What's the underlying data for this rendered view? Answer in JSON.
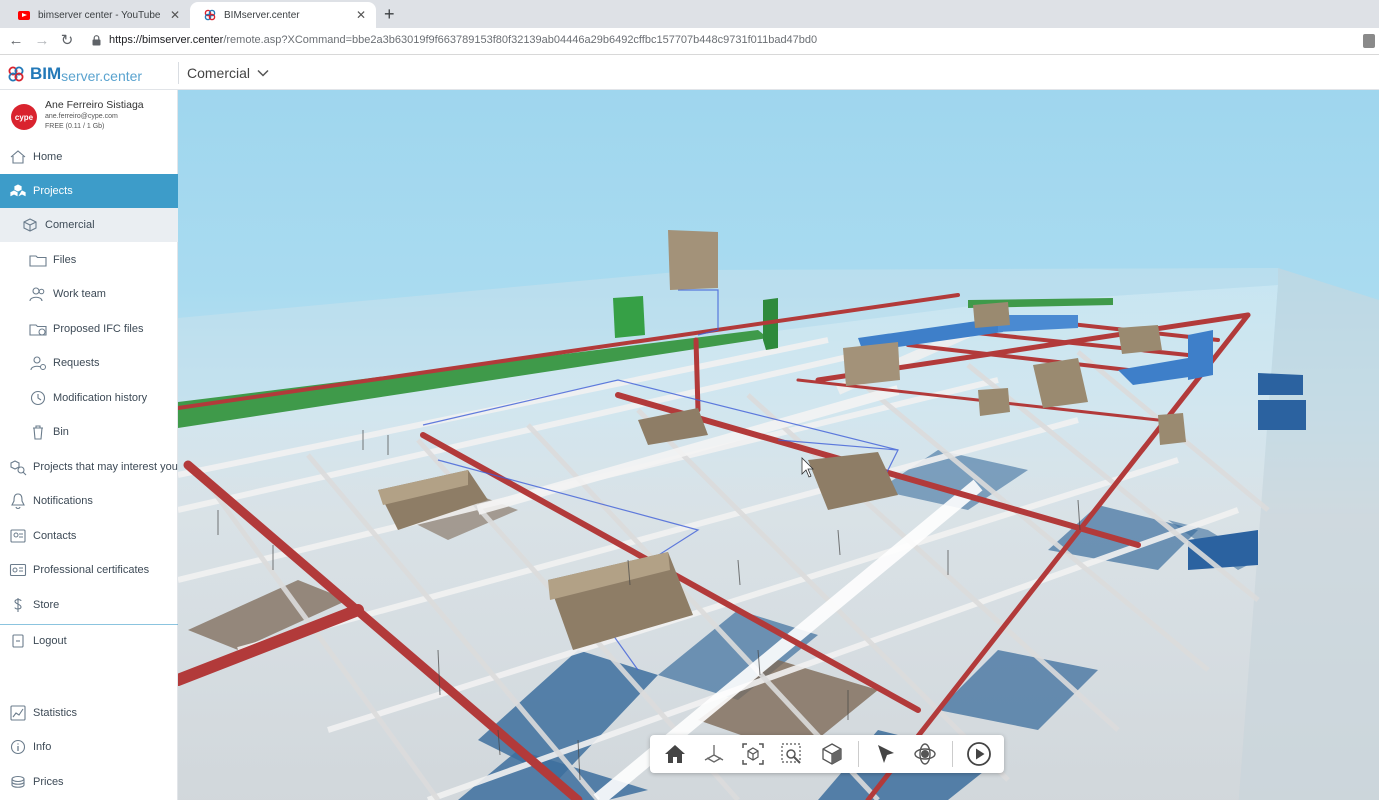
{
  "browser": {
    "tabs": [
      {
        "title": "bimserver center - YouTube",
        "active": false,
        "icon": "youtube-icon"
      },
      {
        "title": "BIMserver.center",
        "active": true,
        "icon": "bimserver-favicon"
      }
    ],
    "url_host": "https://bimserver.center",
    "url_path": "/remote.asp?XCommand=bbe2a3b63019f9f663789153f80f32139ab04446a29b6492cffbc157707b448c9731f011bad47bd0"
  },
  "header": {
    "brand_bold": "BIM",
    "brand_light": "server.center",
    "project_name": "Comercial"
  },
  "user": {
    "name": "Ane Ferreiro Sistiaga",
    "email": "ane.ferreiro@cype.com",
    "plan": "FREE (0.11 / 1 Gb)",
    "avatar_text": "cype"
  },
  "sidebar": {
    "home": "Home",
    "projects": "Projects",
    "current_project": "Comercial",
    "files": "Files",
    "work_team": "Work team",
    "proposed_ifc": "Proposed IFC files",
    "requests": "Requests",
    "modification_history": "Modification history",
    "bin": "Bin",
    "projects_interest": "Projects that may interest you",
    "notifications": "Notifications",
    "contacts": "Contacts",
    "certificates": "Professional certificates",
    "store": "Store",
    "logout": "Logout",
    "statistics": "Statistics",
    "info": "Info",
    "prices": "Prices"
  },
  "colors": {
    "accent": "#3d9cc9",
    "brand": "#2379b8",
    "pipe_red": "#b23a3a",
    "duct_blue": "#3e7fc9",
    "duct_green": "#3f9a4a",
    "equipment_tan": "#a39279"
  },
  "viewer_toolbar": [
    "home-view-icon",
    "axes-icon",
    "fit-box-icon",
    "zoom-window-icon",
    "section-box-icon",
    "select-pointer-icon",
    "orbit-icon",
    "play-icon"
  ]
}
